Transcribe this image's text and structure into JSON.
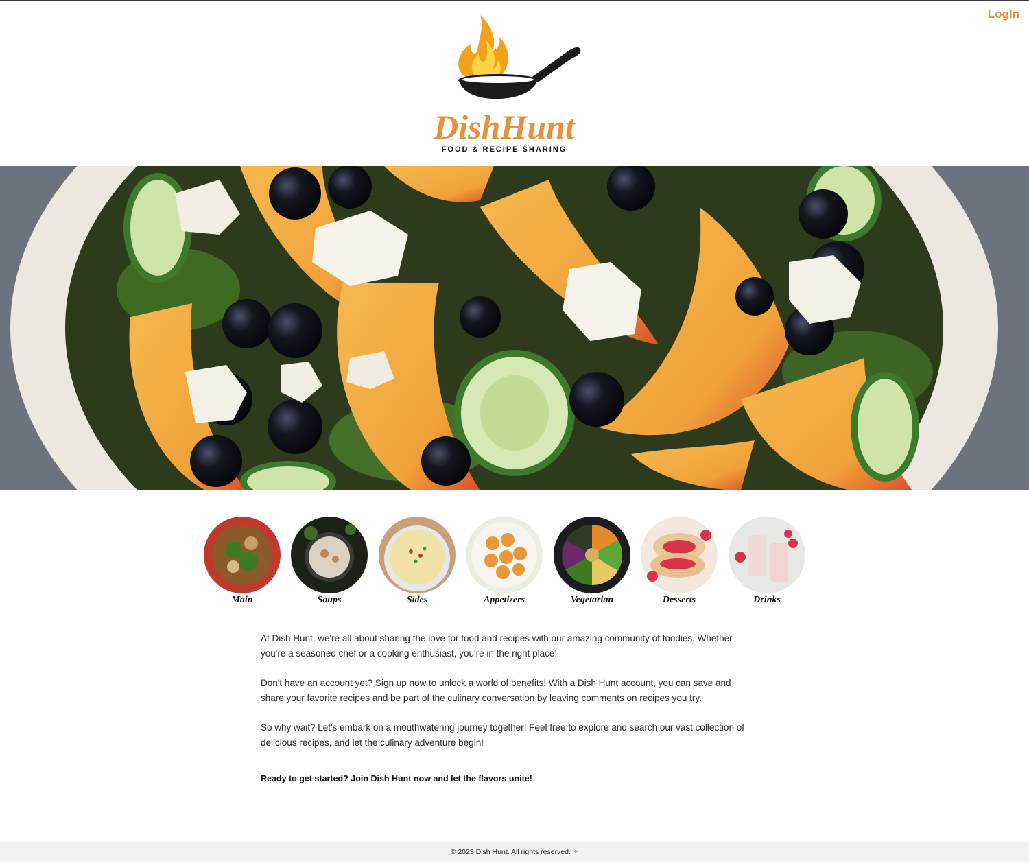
{
  "header": {
    "login_label": "LogIn",
    "logo": {
      "brand": "DishHunt",
      "tagline": "FOOD & RECIPE SHARING",
      "brand_color": "#e8913a",
      "icon": "flaming-pan-icon"
    }
  },
  "hero": {
    "image": "peach-blueberry-cucumber-feta-salad"
  },
  "categories": [
    {
      "label": "Main",
      "image": "stir-fry-bowl"
    },
    {
      "label": "Soups",
      "image": "creamy-soup-pot"
    },
    {
      "label": "Sides",
      "image": "mashed-potatoes-bowl"
    },
    {
      "label": "Appetizers",
      "image": "stuffed-bites-plate"
    },
    {
      "label": "Vegetarian",
      "image": "veggie-buddha-bowl"
    },
    {
      "label": "Desserts",
      "image": "strawberry-hand-pies"
    },
    {
      "label": "Drinks",
      "image": "strawberry-milkshakes"
    }
  ],
  "about": {
    "paragraphs": [
      "At Dish Hunt, we're all about sharing the love for food and recipes with our amazing community of foodies. Whether you're a seasoned chef or a cooking enthusiast, you're in the right place!",
      "Don't have an account yet? Sign up now to unlock a world of benefits! With a Dish Hunt account, you can save and share your favorite recipes and be part of the culinary conversation by leaving comments on recipes you try.",
      "So why wait? Let's embark on a mouthwatering journey together! Feel free to explore and search our vast collection of delicious recipes, and let the culinary adventure begin!"
    ],
    "cta": "Ready to get started? Join Dish Hunt now and let the flavors unite!"
  },
  "footer": {
    "copyright": "© 2023 Dish Hunt. All rights reserved."
  },
  "colors": {
    "accent": "#e8913a",
    "footer_bg": "#f2f2f2"
  }
}
